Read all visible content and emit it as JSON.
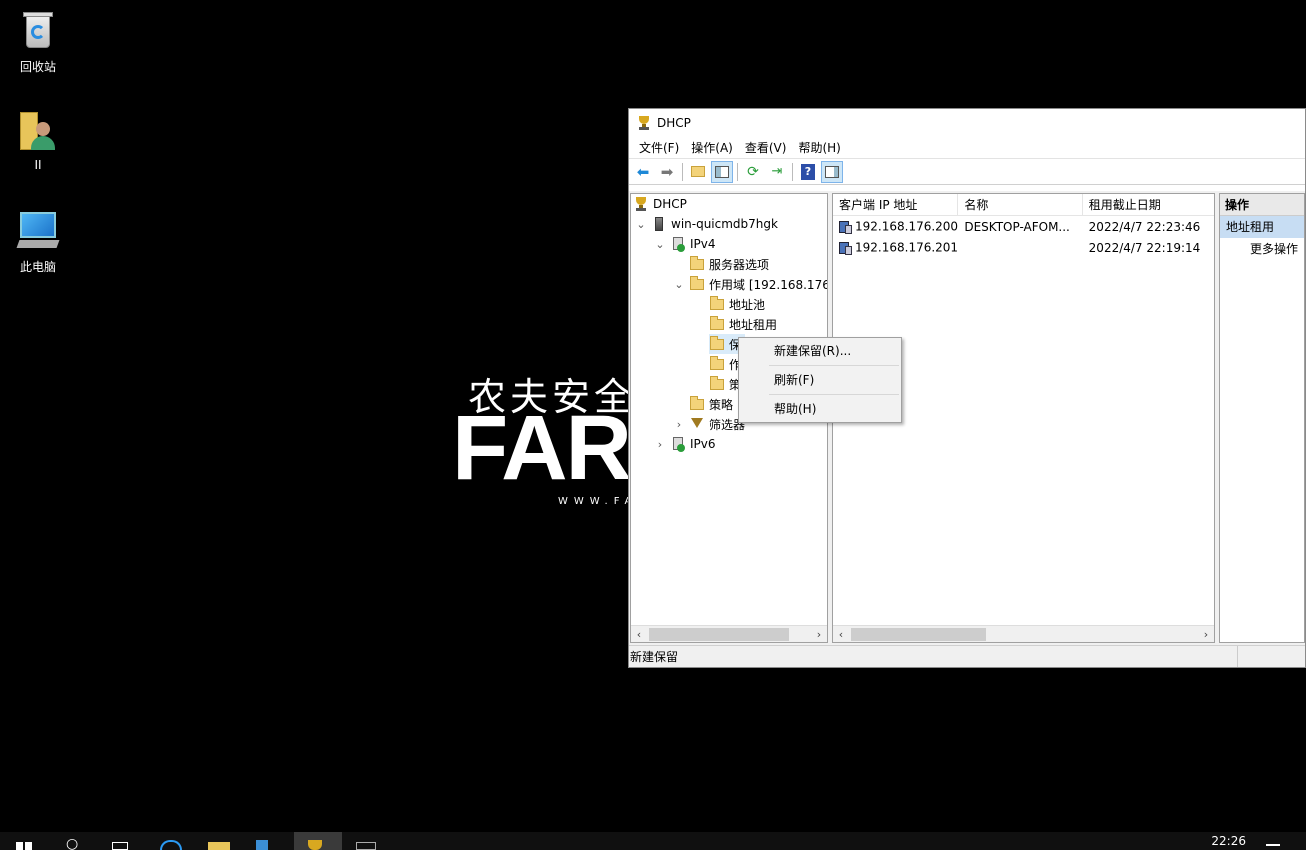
{
  "desktop": {
    "icons": [
      {
        "label": "回收站"
      },
      {
        "label": "II"
      },
      {
        "label": "此电脑"
      }
    ],
    "watermark": {
      "cn": "农夫安全",
      "en": "FARM",
      "url": "WWW.FA"
    }
  },
  "window": {
    "title": "DHCP",
    "menu": [
      "文件(F)",
      "操作(A)",
      "查看(V)",
      "帮助(H)"
    ],
    "tree": {
      "root": "DHCP",
      "server": "win-quicmdb7hgk",
      "ipv4": "IPv4",
      "server_options": "服务器选项",
      "scope": "作用域 [192.168.176.",
      "address_pool": "地址池",
      "address_leases": "地址租用",
      "reservations": "保",
      "scope_options": "作",
      "policies_sub": "策",
      "policies": "策略",
      "filters": "筛选器",
      "ipv6": "IPv6"
    },
    "list": {
      "columns": [
        "客户端 IP 地址",
        "名称",
        "租用截止日期"
      ],
      "rows": [
        {
          "ip": "192.168.176.200",
          "name": "DESKTOP-AFOM...",
          "expiry": "2022/4/7 22:23:46"
        },
        {
          "ip": "192.168.176.201",
          "name": "",
          "expiry": "2022/4/7 22:19:14"
        }
      ]
    },
    "actions": {
      "header": "操作",
      "selected": "地址租用",
      "more": "更多操作"
    },
    "status": "新建保留"
  },
  "context_menu": {
    "items": [
      "新建保留(R)...",
      "刷新(F)",
      "帮助(H)"
    ]
  },
  "taskbar": {
    "clock": "22:26"
  },
  "colors": {
    "selection": "#c7ddf3",
    "toolbar_selected": "#cde6f7",
    "desktop": "#000000"
  }
}
